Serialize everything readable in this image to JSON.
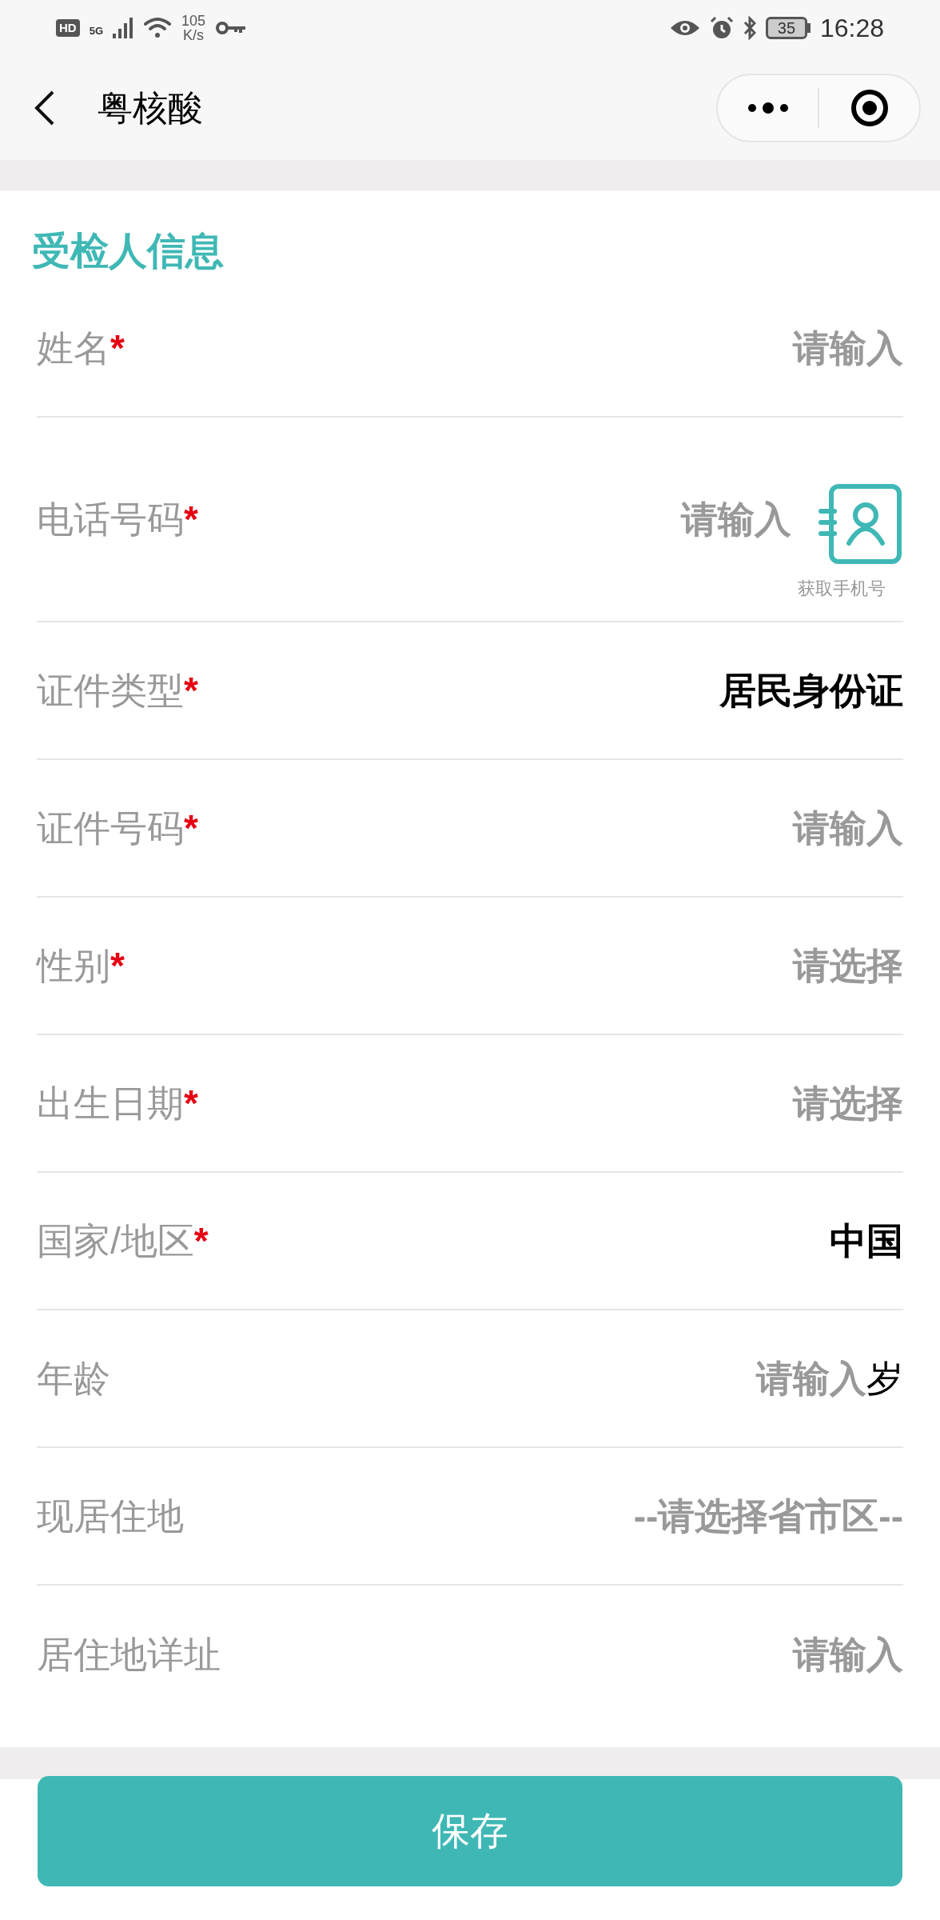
{
  "status_bar": {
    "hd": "HD",
    "network": "5G",
    "speed_value": "105",
    "speed_unit": "K/s",
    "battery": "35",
    "time": "16:28"
  },
  "nav": {
    "title": "粤核酸"
  },
  "section": {
    "title": "受检人信息",
    "fields": [
      {
        "kind": "input",
        "label": "姓名",
        "required_mark": "*",
        "placeholder": "请输入"
      },
      {
        "kind": "phone",
        "label": "电话号码",
        "required_mark": "*",
        "placeholder": "请输入",
        "action_label": "获取手机号"
      },
      {
        "kind": "select",
        "label": "证件类型",
        "required_mark": "*",
        "value": "居民身份证"
      },
      {
        "kind": "input",
        "label": "证件号码",
        "required_mark": "*",
        "placeholder": "请输入"
      },
      {
        "kind": "select",
        "label": "性别",
        "required_mark": "*",
        "placeholder": "请选择"
      },
      {
        "kind": "select",
        "label": "出生日期",
        "required_mark": "*",
        "placeholder": "请选择"
      },
      {
        "kind": "select",
        "label": "国家/地区",
        "required_mark": "*",
        "value": "中国"
      },
      {
        "kind": "input",
        "label": "年龄",
        "placeholder": "请输入",
        "suffix": "岁"
      },
      {
        "kind": "select",
        "label": "现居住地",
        "placeholder": "--请选择省市区--"
      },
      {
        "kind": "input",
        "label": "居住地详址",
        "placeholder": "请输入"
      }
    ]
  },
  "save_button": "保存"
}
